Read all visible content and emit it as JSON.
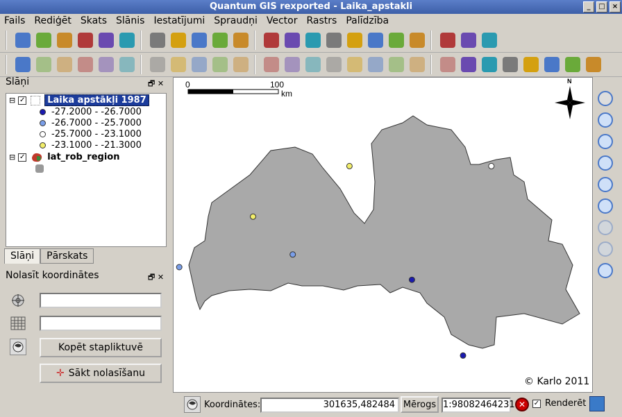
{
  "window": {
    "title": "Quantum GIS rexported - Laika_apstakli",
    "buttons": [
      "_",
      "□",
      "×"
    ]
  },
  "menu": [
    "Fails",
    "Rediģēt",
    "Skats",
    "Slānis",
    "Iestatījumi",
    "Spraudņi",
    "Vector",
    "Rastrs",
    "Palīdzība"
  ],
  "layers_panel": {
    "title": "Slāņi",
    "float_btn": "🗗",
    "close_btn": "✕",
    "layer1": {
      "name": "Laika apstākļi 1987",
      "checked": "✓",
      "legend": [
        {
          "label": "-27.2000 - -26.7000",
          "color": "#1a1ab0"
        },
        {
          "label": "-26.7000 - -25.7000",
          "color": "#7a9ee8"
        },
        {
          "label": "-25.7000 - -23.1000",
          "color": "#ffffff"
        },
        {
          "label": "-23.1000 - -21.3000",
          "color": "#f2ee6a"
        }
      ]
    },
    "layer2": {
      "name": "lat_rob_region",
      "checked": "✓"
    },
    "expand": "⊟"
  },
  "tabs": [
    "Slāņi",
    "Pārskats"
  ],
  "coord_panel": {
    "title": "Nolasīt koordinātes",
    "float_btn": "🗗",
    "close_btn": "✕",
    "copy_btn": "Kopēt stapliktuvē",
    "start_btn": "Sākt nolasīšanu",
    "field1": "",
    "field2": ""
  },
  "map": {
    "scale_0": "0",
    "scale_100": "100",
    "scale_unit": "km",
    "north": "N",
    "copyright": "© Karlo 2011",
    "points": [
      {
        "lon": 24.0,
        "lat": 57.4,
        "color": "#f2ee6a"
      },
      {
        "lon": 26.5,
        "lat": 57.4,
        "color": "#ffffff"
      },
      {
        "lon": 22.3,
        "lat": 57.0,
        "color": "#f2ee6a"
      },
      {
        "lon": 21.0,
        "lat": 56.6,
        "color": "#7a9ee8"
      },
      {
        "lon": 23.0,
        "lat": 56.7,
        "color": "#7a9ee8"
      },
      {
        "lon": 25.1,
        "lat": 56.5,
        "color": "#1a1ab0"
      },
      {
        "lon": 26.0,
        "lat": 55.9,
        "color": "#1a1ab0"
      }
    ]
  },
  "status": {
    "coord_label": "Koordinātes:",
    "coord_value": "301635,482484",
    "scale_label": "Mērogs",
    "scale_value": "1:98082464231",
    "render_label": "Renderēt",
    "render_checked": "✓"
  },
  "icons": {
    "toolbar1": [
      "new-file",
      "open",
      "save",
      "save-as",
      "print-layout",
      "print",
      "add-vector",
      "add-raster",
      "add-postgis",
      "add-spatialite",
      "new-layer",
      "remove-layer",
      "identify",
      "select",
      "deselect",
      "attribute-table",
      "measure",
      "annotation",
      "home",
      "home-next",
      "label",
      "text-annotation"
    ],
    "toolbar2": [
      "edit-pencil",
      "save-edits",
      "move",
      "node",
      "delete",
      "cut",
      "copy",
      "paste",
      "undo",
      "redo",
      "add-ring",
      "add-part",
      "simplify",
      "delete-ring",
      "delete-part",
      "reshape",
      "split",
      "merge",
      "offset",
      "rotate",
      "copyright",
      "decoration",
      "georef",
      "north-arrow",
      "scalebar",
      "zoom-tool",
      "sync"
    ],
    "right": [
      "pan",
      "zoom-in",
      "zoom-out",
      "zoom-full",
      "zoom-selection",
      "zoom-layer",
      "zoom-last",
      "zoom-next",
      "refresh"
    ]
  }
}
